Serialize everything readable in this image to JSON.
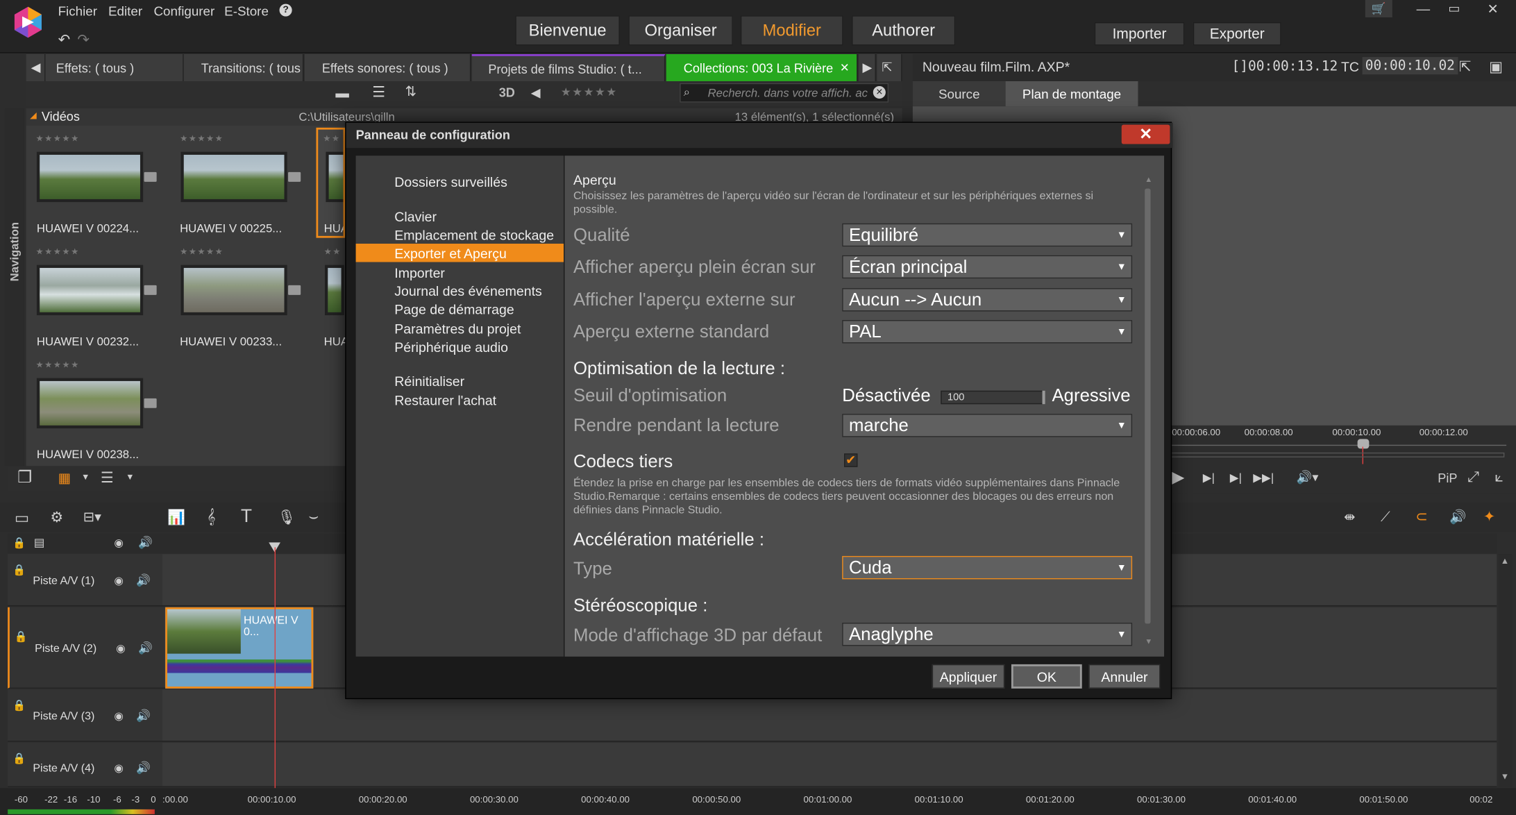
{
  "menu": {
    "file": "Fichier",
    "edit": "Editer",
    "configure": "Configurer",
    "estore": "E-Store",
    "help": "?"
  },
  "nav_tabs": [
    "Bienvenue",
    "Organiser",
    "Modifier",
    "Authorer"
  ],
  "top_buttons": {
    "import": "Importer",
    "export": "Exporter"
  },
  "library_tabs": [
    "Effets: ( tous )",
    "Transitions: ( tous )",
    "Effets sonores: ( tous )",
    "Projets de films Studio: ( t...",
    "Collections: 003 La Rivière"
  ],
  "library_toolbar": {
    "three_d": "3D",
    "search_placeholder": "Recherch. dans votre affich. ac"
  },
  "library_header": {
    "title": "Vidéos",
    "path": "C:\\Utilisateurs\\gilln",
    "count": "13 élément(s), 1 sélectionné(s)"
  },
  "side_label": "Navigation",
  "library_items": [
    {
      "name": "HUAWEI V 00224..."
    },
    {
      "name": "HUAWEI V 00225..."
    },
    {
      "name": "HUA"
    },
    {
      "name": "HUAWEI V 00232..."
    },
    {
      "name": "HUAWEI V 00233..."
    },
    {
      "name": "HUA"
    },
    {
      "name": "HUAWEI V 00238..."
    }
  ],
  "right_panel": {
    "project": "Nouveau film.Film. AXP*",
    "timecode": "[]00:00:13.12",
    "tc_label": "TC",
    "tc_value": "00:00:10.02",
    "tab_source": "Source",
    "tab_timeline": "Plan de montage"
  },
  "preview_ruler": [
    "00:00:06.00",
    "00:00:08.00",
    "00:00:10.00",
    "00:00:12.00"
  ],
  "pip_label": "PiP",
  "tracks": [
    {
      "name": "Piste A/V (1)"
    },
    {
      "name": "Piste A/V (2)"
    },
    {
      "name": "Piste A/V (3)"
    },
    {
      "name": "Piste A/V (4)"
    }
  ],
  "clip_label": "HUAWEI V 0...",
  "meter_labels": [
    "-60",
    "-22",
    "-16",
    "-10",
    "-6",
    "-3",
    "0"
  ],
  "ruler_labels": [
    ":00.00",
    "00:00:10.00",
    "00:00:20.00",
    "00:00:30.00",
    "00:00:40.00",
    "00:00:50.00",
    "00:01:00.00",
    "00:01:10.00",
    "00:01:20.00",
    "00:01:30.00",
    "00:01:40.00",
    "00:01:50.00",
    "00:02"
  ],
  "dialog": {
    "title": "Panneau de configuration",
    "close": "✕",
    "nav_items": [
      "Dossiers surveillés",
      "Clavier",
      "Emplacement de stockage",
      "Exporter et Aperçu",
      "Importer",
      "Journal des événements",
      "Page de démarrage",
      "Paramètres du projet",
      "Périphérique audio",
      "Réinitialiser",
      "Restaurer l'achat"
    ],
    "selected_item": "Exporter et Aperçu",
    "section_title": "Aperçu",
    "section_desc": "Choisissez les paramètres de l'aperçu vidéo sur l'écran de l'ordinateur et sur les périphériques externes si possible.",
    "quality_label": "Qualité",
    "quality_value": "Equilibré",
    "fullscreen_label": "Afficher aperçu plein écran sur",
    "fullscreen_value": "Écran principal",
    "external_label": "Afficher l'aperçu externe sur",
    "external_value": "Aucun --> Aucun",
    "standard_label": "Aperçu externe standard",
    "standard_value": "PAL",
    "playback_title": "Optimisation de la lecture :",
    "threshold_label": "Seuil d'optimisation",
    "threshold_min": "Désactivée",
    "threshold_max": "Agressive",
    "threshold_value": "100",
    "render_label": "Rendre pendant la lecture",
    "render_value": "marche",
    "codecs_title": "Codecs tiers",
    "codecs_checked": true,
    "codecs_desc": "Étendez la prise en charge par les ensembles de codecs tiers de formats vidéo supplémentaires dans Pinnacle Studio.Remarque : certains ensembles de codecs tiers peuvent occasionner des blocages ou des erreurs non définies dans Pinnacle Studio.",
    "hw_title": "Accélération matérielle :",
    "type_label": "Type",
    "type_value": "Cuda",
    "stereo_title": "Stéréoscopique :",
    "mode3d_label": "Mode d'affichage 3D par défaut",
    "mode3d_value": "Anaglyphe",
    "btn_apply": "Appliquer",
    "btn_ok": "OK",
    "btn_cancel": "Annuler"
  },
  "colors": {
    "accent": "#f08b1a",
    "active_tab": "#27a81f",
    "close": "#c0392b"
  }
}
